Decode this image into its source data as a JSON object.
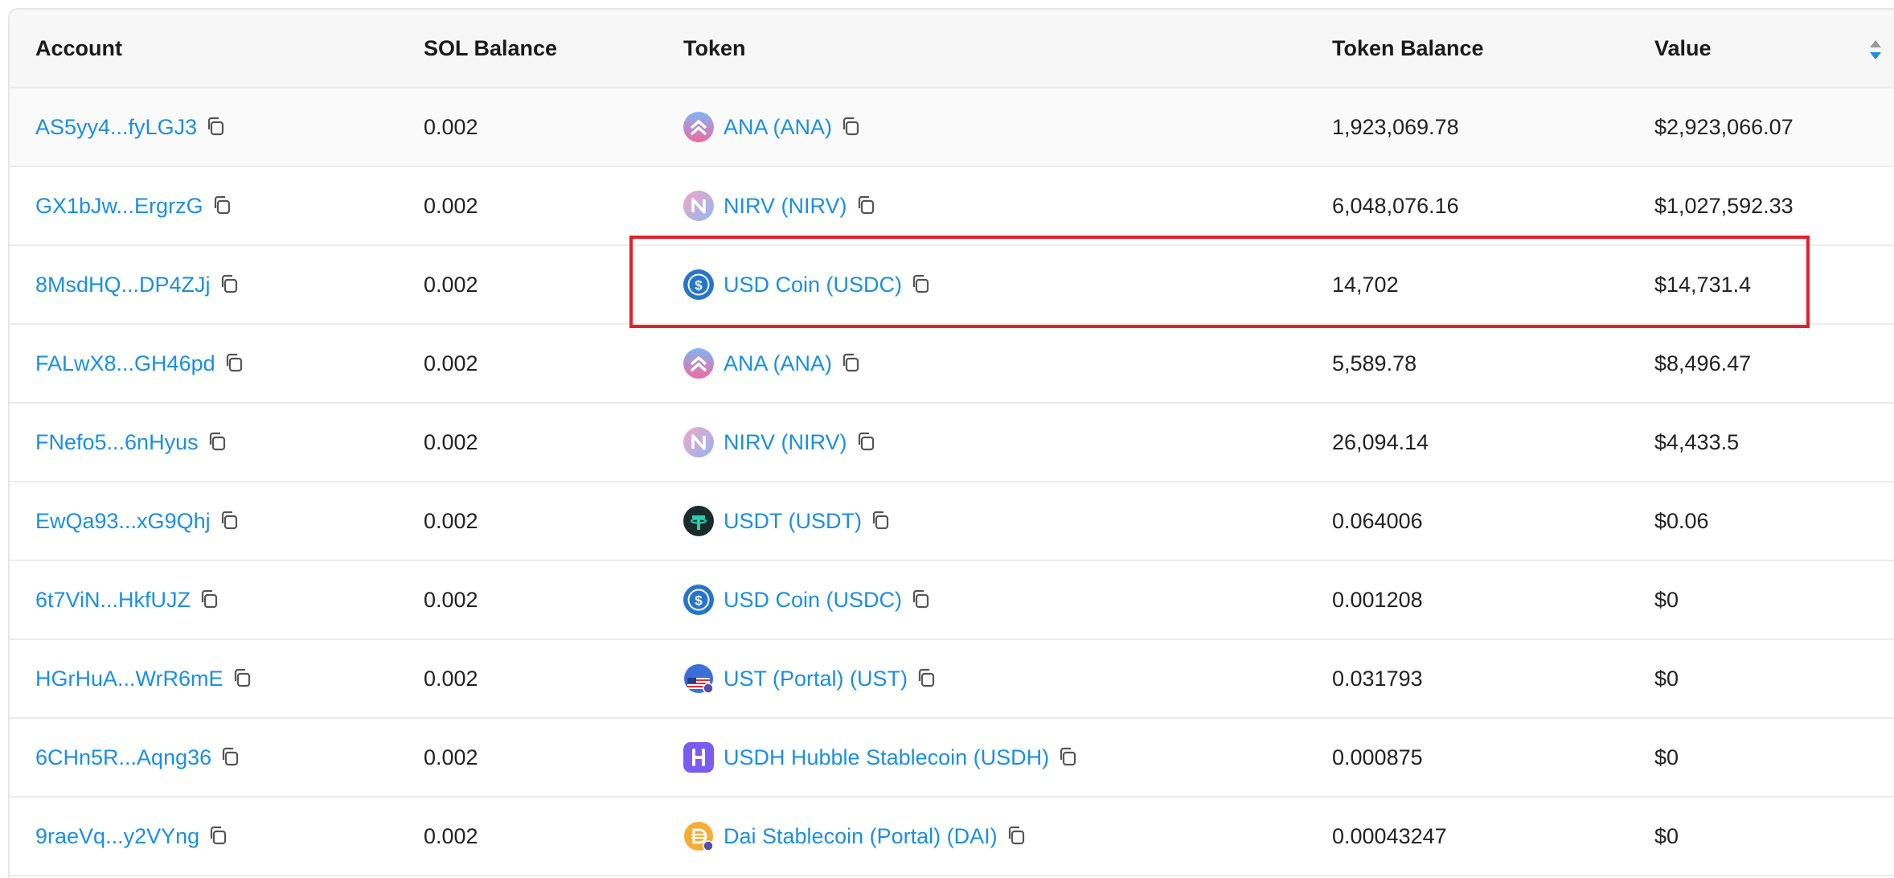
{
  "headers": {
    "account": "Account",
    "sol_balance": "SOL Balance",
    "token": "Token",
    "token_balance": "Token Balance",
    "value": "Value"
  },
  "rows": [
    {
      "account": "AS5yy4...fyLGJ3",
      "sol": "0.002",
      "token": "ANA (ANA)",
      "logo": "ana",
      "token_balance": "1,923,069.78",
      "value": "$2,923,066.07"
    },
    {
      "account": "GX1bJw...ErgrzG",
      "sol": "0.002",
      "token": "NIRV (NIRV)",
      "logo": "nirv",
      "token_balance": "6,048,076.16",
      "value": "$1,027,592.33"
    },
    {
      "account": "8MsdHQ...DP4ZJj",
      "sol": "0.002",
      "token": "USD Coin (USDC)",
      "logo": "usdc",
      "token_balance": "14,702",
      "value": "$14,731.4"
    },
    {
      "account": "FALwX8...GH46pd",
      "sol": "0.002",
      "token": "ANA (ANA)",
      "logo": "ana",
      "token_balance": "5,589.78",
      "value": "$8,496.47"
    },
    {
      "account": "FNefo5...6nHyus",
      "sol": "0.002",
      "token": "NIRV (NIRV)",
      "logo": "nirv",
      "token_balance": "26,094.14",
      "value": "$4,433.5"
    },
    {
      "account": "EwQa93...xG9Qhj",
      "sol": "0.002",
      "token": "USDT (USDT)",
      "logo": "usdt",
      "token_balance": "0.064006",
      "value": "$0.06"
    },
    {
      "account": "6t7ViN...HkfUJZ",
      "sol": "0.002",
      "token": "USD Coin (USDC)",
      "logo": "usdc",
      "token_balance": "0.001208",
      "value": "$0"
    },
    {
      "account": "HGrHuA...WrR6mE",
      "sol": "0.002",
      "token": "UST (Portal) (UST)",
      "logo": "ust",
      "token_balance": "0.031793",
      "value": "$0"
    },
    {
      "account": "6CHn5R...Aqng36",
      "sol": "0.002",
      "token": "USDH Hubble Stablecoin (USDH)",
      "logo": "usdh",
      "token_balance": "0.000875",
      "value": "$0"
    },
    {
      "account": "9raeVq...y2VYng",
      "sol": "0.002",
      "token": "Dai Stablecoin (Portal) (DAI)",
      "logo": "dai",
      "token_balance": "0.00043247",
      "value": "$0"
    }
  ],
  "colors": {
    "link": "#1a8fe3",
    "highlight": "#e3202a",
    "header_bg": "#f7f7f7"
  },
  "highlighted_row": 2
}
